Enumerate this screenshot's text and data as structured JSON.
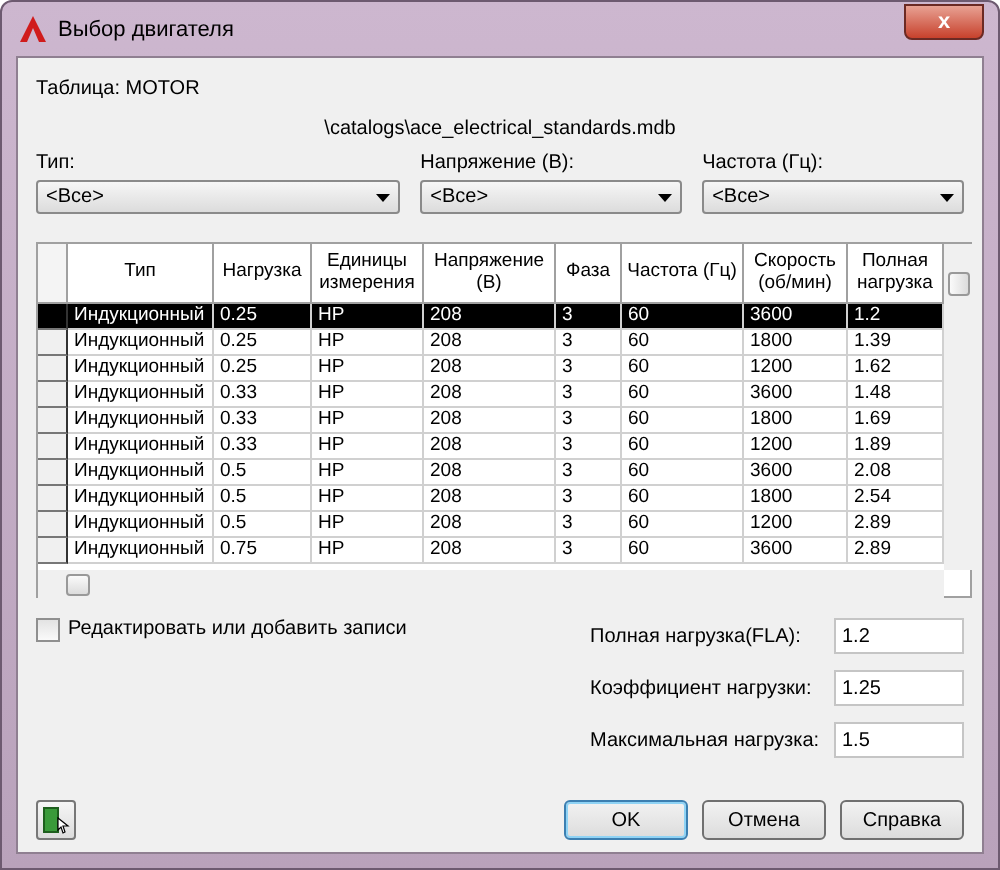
{
  "window": {
    "title": "Выбор двигателя",
    "close": "x"
  },
  "table_name": "Таблица: MOTOR",
  "path": "\\catalogs\\ace_electrical_standards.mdb",
  "filters": [
    {
      "label": "Тип:",
      "value": "<Все>"
    },
    {
      "label": "Напряжение (В):",
      "value": "<Все>"
    },
    {
      "label": "Частота (Гц):",
      "value": "<Все>"
    }
  ],
  "table": {
    "columns": [
      "Тип",
      "Нагрузка",
      "Единицы измерения",
      "Напряжение (В)",
      "Фаза",
      "Частота (Гц)",
      "Скорость (об/мин)",
      "Полная нагрузка"
    ],
    "rows": [
      {
        "selected": true,
        "cells": [
          "Индукционный",
          "0.25",
          "HP",
          "208",
          "3",
          "60",
          "3600",
          "1.2"
        ]
      },
      {
        "selected": false,
        "cells": [
          "Индукционный",
          "0.25",
          "HP",
          "208",
          "3",
          "60",
          "1800",
          "1.39"
        ]
      },
      {
        "selected": false,
        "cells": [
          "Индукционный",
          "0.25",
          "HP",
          "208",
          "3",
          "60",
          "1200",
          "1.62"
        ]
      },
      {
        "selected": false,
        "cells": [
          "Индукционный",
          "0.33",
          "HP",
          "208",
          "3",
          "60",
          "3600",
          "1.48"
        ]
      },
      {
        "selected": false,
        "cells": [
          "Индукционный",
          "0.33",
          "HP",
          "208",
          "3",
          "60",
          "1800",
          "1.69"
        ]
      },
      {
        "selected": false,
        "cells": [
          "Индукционный",
          "0.33",
          "HP",
          "208",
          "3",
          "60",
          "1200",
          "1.89"
        ]
      },
      {
        "selected": false,
        "cells": [
          "Индукционный",
          "0.5",
          "HP",
          "208",
          "3",
          "60",
          "3600",
          "2.08"
        ]
      },
      {
        "selected": false,
        "cells": [
          "Индукционный",
          "0.5",
          "HP",
          "208",
          "3",
          "60",
          "1800",
          "2.54"
        ]
      },
      {
        "selected": false,
        "cells": [
          "Индукционный",
          "0.5",
          "HP",
          "208",
          "3",
          "60",
          "1200",
          "2.89"
        ]
      },
      {
        "selected": false,
        "cells": [
          "Индукционный",
          "0.75",
          "HP",
          "208",
          "3",
          "60",
          "3600",
          "2.89"
        ]
      }
    ]
  },
  "edit_checkbox": {
    "label": "Редактировать или добавить записи",
    "checked": false
  },
  "fields": [
    {
      "label": "Полная нагрузка(FLA):",
      "value": "1.2"
    },
    {
      "label": "Коэффициент нагрузки:",
      "value": "1.25"
    },
    {
      "label": "Максимальная нагрузка:",
      "value": "1.5"
    }
  ],
  "buttons": [
    {
      "label": "OK",
      "default": true
    },
    {
      "label": "Отмена",
      "default": false
    },
    {
      "label": "Справка",
      "default": false
    }
  ]
}
